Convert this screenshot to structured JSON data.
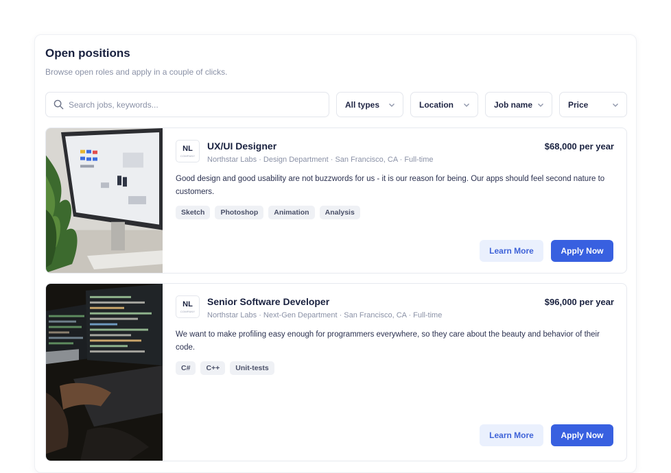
{
  "header": {
    "title": "Open positions",
    "subtitle": "Browse open roles and apply in a couple of clicks."
  },
  "search": {
    "placeholder": "Search jobs, keywords..."
  },
  "filters": [
    {
      "label": "All types"
    },
    {
      "label": "Location"
    },
    {
      "label": "Job name"
    },
    {
      "label": "Price"
    }
  ],
  "jobs": [
    {
      "logo_mark": "NL",
      "logo_sub": "COMPANY",
      "title": "UX/UI Designer",
      "meta": "Northstar Labs · Design Department · San Francisco, CA · Full-time",
      "salary": "$68,000 per year",
      "description": "Good design and good usability are not buzzwords for us - it is our reason for being. Our apps should feel second nature to customers.",
      "tags": [
        "Sketch",
        "Photoshop",
        "Animation",
        "Analysis"
      ],
      "learn_label": "Learn More",
      "apply_label": "Apply Now"
    },
    {
      "logo_mark": "NL",
      "logo_sub": "COMPANY",
      "title": "Senior Software Developer",
      "meta": "Northstar Labs · Next-Gen Department · San Francisco, CA · Full-time",
      "salary": "$96,000 per year",
      "description": "We want to make profiling easy enough for programmers everywhere, so they care about the beauty and behavior of their code.",
      "tags": [
        "C#",
        "C++",
        "Unit-tests"
      ],
      "learn_label": "Learn More",
      "apply_label": "Apply Now"
    }
  ],
  "colors": {
    "accent": "#3860e0",
    "accent_light": "#eaf0fd",
    "text_primary": "#19213f",
    "text_muted": "#8a91a6",
    "tag_bg": "#eff1f5"
  }
}
